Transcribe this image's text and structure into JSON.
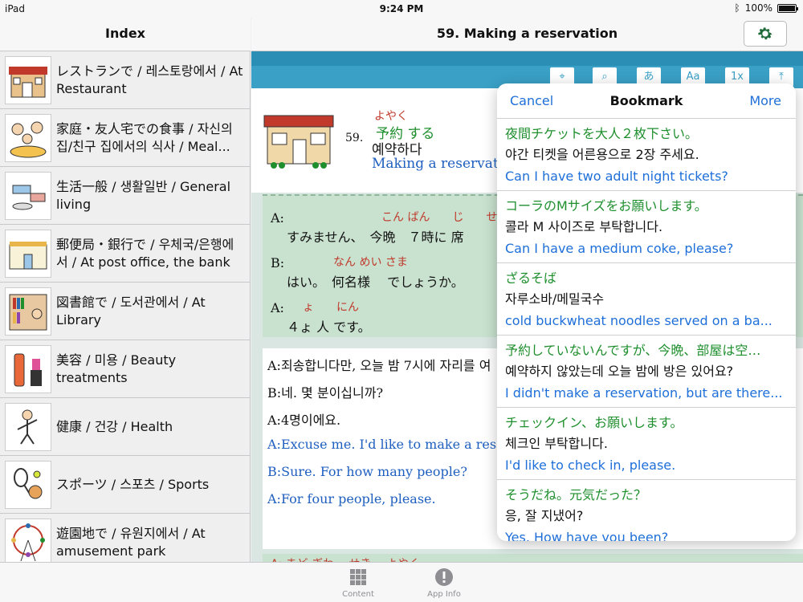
{
  "status": {
    "device": "iPad",
    "time": "9:24 PM",
    "battery": "100%"
  },
  "index": {
    "title": "Index",
    "items": [
      {
        "label": "レストランで / 레스토랑에서 / At Restaurant",
        "icon": "restaurant-icon"
      },
      {
        "label": "家庭・友人宅での食事 / 자신의 집/친구 집에서의 식사 / Meal...",
        "icon": "family-meal-icon"
      },
      {
        "label": "生活一般 / 생활일반 / General living",
        "icon": "general-living-icon"
      },
      {
        "label": "郵便局・銀行で / 우체국/은행에서 / At post office, the bank",
        "icon": "post-office-icon"
      },
      {
        "label": "図書館で / 도서관에서 / At Library",
        "icon": "library-icon"
      },
      {
        "label": "美容 / 미용 / Beauty treatments",
        "icon": "beauty-icon"
      },
      {
        "label": "健康 / 건강 / Health",
        "icon": "health-icon"
      },
      {
        "label": "スポーツ / 스포츠 / Sports",
        "icon": "sports-icon"
      },
      {
        "label": "遊園地で / 유원지에서 / At amusement park",
        "icon": "amusement-park-icon"
      }
    ]
  },
  "content": {
    "title": "59. Making a reservation",
    "toolbar": [
      "あ",
      "Aa",
      "1x"
    ],
    "lesson": {
      "number": "59.",
      "ruby": "よやく",
      "ja": "予約 する",
      "ko": "예약하다",
      "en": "Making a reservatio"
    },
    "dialog": [
      {
        "speaker": "A:",
        "ruby": "こん ばん　　じ　　せ",
        "ja": "すみません、　今晩　７時に 席"
      },
      {
        "speaker": "B:",
        "ruby": "なん めい さま",
        "ja": "はい。　何名様　 でしょうか。"
      },
      {
        "speaker": "A:",
        "ruby": "ょ　　にん",
        "ja": "４ょ  人  です。"
      }
    ],
    "translations": [
      "A:죄송합니다만, 오늘 밤 7시에 자리를 여",
      "B:네. 몇 분이십니까?",
      "A:4명이에요.",
      "A:Excuse me. I'd like to make a reser",
      "B:Sure. For how many people?",
      "A:For four people, please."
    ],
    "next_line": "A: まど ぎわ　 せき　 よやく"
  },
  "bookmark": {
    "cancel": "Cancel",
    "title": "Bookmark",
    "more": "More",
    "items": [
      {
        "ja": "夜間チケットを大人２枚下さい。",
        "ko": "야간 티켓을 어른용으로 2장 주세요.",
        "en": "Can I have two adult night tickets?"
      },
      {
        "ja": "コーラのMサイズをお願いします。",
        "ko": "콜라 M 사이즈로 부탁합니다.",
        "en": "Can I have a medium coke, please?"
      },
      {
        "ja": "ざるそば",
        "ko": "자루소바/메밀국수",
        "en": "cold buckwheat noodles served on a  ba..."
      },
      {
        "ja": "予約していないんですが、今晩、部屋は空…",
        "ko": "예약하지 않았는데 오늘 밤에 방은 있어요?",
        "en": "I didn't make a reservation, but are there..."
      },
      {
        "ja": "チェックイン、お願いします。",
        "ko": "체크인 부탁합니다.",
        "en": "I'd like to check in, please."
      },
      {
        "ja": "そうだね。元気だった？",
        "ko": "응, 잘 지냈어?",
        "en": "Yes. How have you been?"
      }
    ]
  },
  "tabs": [
    {
      "label": "Content",
      "icon": "grid-icon"
    },
    {
      "label": "App Info",
      "icon": "info-icon"
    }
  ],
  "colors": {
    "accent": "#1e6fd9",
    "japanese_text": "#1f8f2e",
    "ruby": "#c0392b",
    "toolbar": "#3aa0c6"
  }
}
